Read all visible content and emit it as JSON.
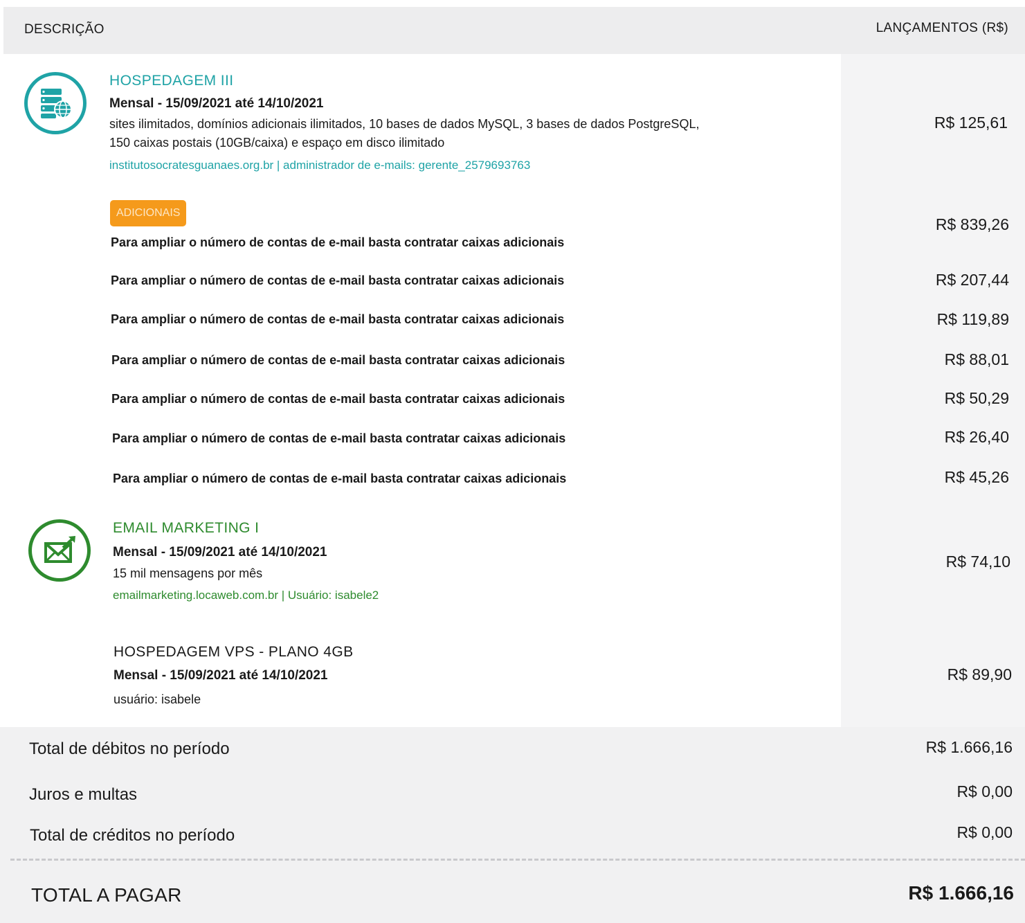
{
  "header": {
    "description": "DESCRIÇÃO",
    "entries": "LANÇAMENTOS (R$)"
  },
  "colors": {
    "teal": "#1fa3a6",
    "green": "#2e8b2e",
    "orange": "#f59a1b"
  },
  "hosting": {
    "icon": "server-globe-icon",
    "title": "HOSPEDAGEM III",
    "period": "Mensal - 15/09/2021 até 14/10/2021",
    "details": "sites ilimitados, domínios adicionais ilimitados, 10 bases de dados MySQL, 3 bases de dados PostgreSQL, 150 caixas postais (10GB/caixa) e espaço em disco ilimitado",
    "link": "institutosocratesguanaes.org.br | administrador de e-mails: gerente_2579693763",
    "amount": "R$ 125,61"
  },
  "additionals": {
    "badge": "ADICIONAIS",
    "header_amount": "R$ 839,26",
    "rows": [
      {
        "text": "Para ampliar o número de contas de e-mail basta contratar caixas adicionais",
        "amount": "R$ 207,44"
      },
      {
        "text": "Para ampliar o número de contas de e-mail basta contratar caixas adicionais",
        "amount": "R$ 119,89"
      },
      {
        "text": "Para ampliar o número de contas de e-mail basta contratar caixas adicionais",
        "amount": "R$ 88,01"
      },
      {
        "text": "Para ampliar o número de contas de e-mail basta contratar caixas adicionais",
        "amount": "R$ 50,29"
      },
      {
        "text": "Para ampliar o número de contas de e-mail basta contratar caixas adicionais",
        "amount": "R$ 26,40"
      },
      {
        "text": "Para ampliar o número de contas de e-mail basta contratar caixas adicionais",
        "amount": "R$ 45,26"
      },
      {
        "text": "Para ampliar o número de contas de e-mail basta contratar caixas adicionais",
        "amount": ""
      }
    ]
  },
  "email_marketing": {
    "icon": "envelope-arrow-icon",
    "title": "EMAIL MARKETING I",
    "period": "Mensal - 15/09/2021 até 14/10/2021",
    "details": "15 mil mensagens por mês",
    "link": "emailmarketing.locaweb.com.br | Usuário: isabele2",
    "amount": "R$ 74,10"
  },
  "vps": {
    "title": "HOSPEDAGEM VPS - PLANO 4GB",
    "period": "Mensal - 15/09/2021 até 14/10/2021",
    "details": "usuário: isabele",
    "amount": "R$ 89,90"
  },
  "totals": {
    "debits_label": "Total de débitos no período",
    "debits_amount": "R$ 1.666,16",
    "interest_label": "Juros e multas",
    "interest_amount": "R$ 0,00",
    "credits_label": "Total de créditos no período",
    "credits_amount": "R$ 0,00",
    "grand_label": "TOTAL A PAGAR",
    "grand_amount": "R$ 1.666,16"
  }
}
